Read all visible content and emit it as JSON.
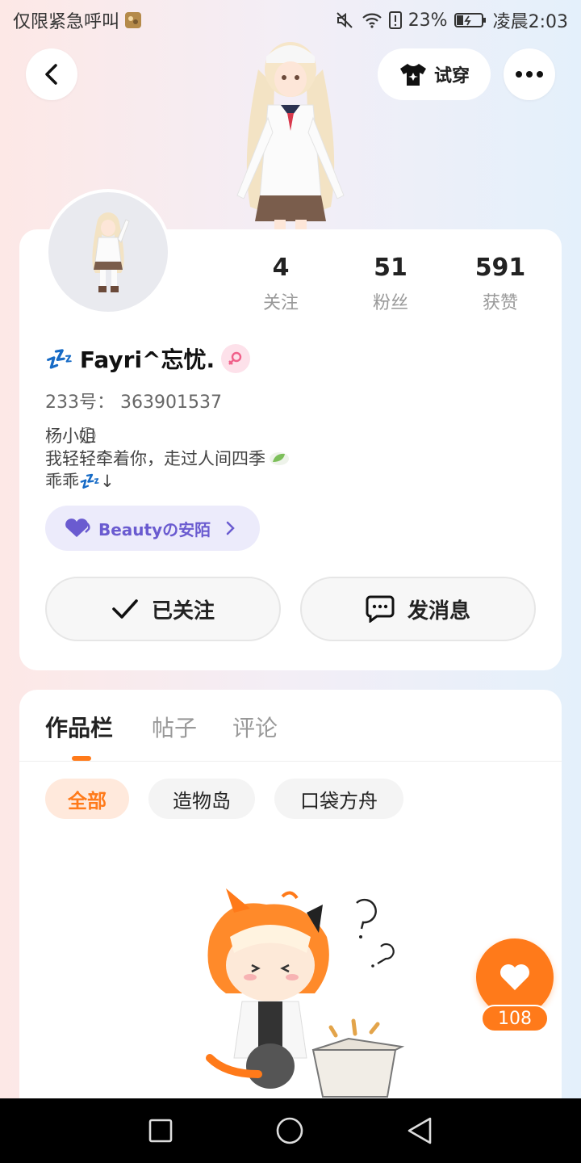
{
  "status_bar": {
    "carrier_text": "仅限紧急呼叫",
    "battery_percent": "23%",
    "time": "凌晨2:03"
  },
  "header": {
    "back_icon": "chevron-left-icon",
    "try_on_label": "试穿",
    "more_icon": "more-dots-icon"
  },
  "profile": {
    "stats": [
      {
        "value": "4",
        "label": "关注"
      },
      {
        "value": "51",
        "label": "粉丝"
      },
      {
        "value": "591",
        "label": "获赞"
      }
    ],
    "name_prefix": "💤",
    "name": "Fayri^忘忧.",
    "gender": "female",
    "uid_text": "233号： 363901537",
    "bio_lines": [
      "杨小姐⃝",
      "我轻轻牵着你，走过人间四季",
      "乖乖💤↓"
    ],
    "group_label": "Beautyの安陌",
    "follow_label": "已关注",
    "message_label": "发消息"
  },
  "content": {
    "tabs": [
      {
        "label": "作品栏",
        "active": true
      },
      {
        "label": "帖子",
        "active": false
      },
      {
        "label": "评论",
        "active": false
      }
    ],
    "filters": [
      {
        "label": "全部",
        "active": true
      },
      {
        "label": "造物岛",
        "active": false
      },
      {
        "label": "口袋方舟",
        "active": false
      }
    ]
  },
  "like_fab": {
    "count": "108"
  },
  "colors": {
    "accent": "#ff7a1a",
    "group_purple": "#6a5bd0"
  }
}
